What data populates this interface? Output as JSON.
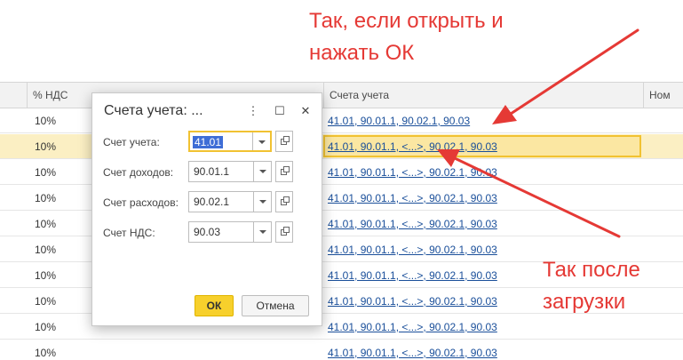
{
  "table": {
    "headers": {
      "vat": "% НДС",
      "accounts": "Счета учета",
      "next": "Ном"
    },
    "rows": [
      {
        "vat": "10%",
        "accounts": "41.01, 90.01.1, 90.02.1, 90.03",
        "selected": false
      },
      {
        "vat": "10%",
        "accounts": "41.01, 90.01.1, <...>, 90.02.1, 90.03",
        "selected": true
      },
      {
        "vat": "10%",
        "accounts": "41.01, 90.01.1, <...>, 90.02.1, 90.03",
        "selected": false
      },
      {
        "vat": "10%",
        "accounts": "41.01, 90.01.1, <...>, 90.02.1, 90.03",
        "selected": false
      },
      {
        "vat": "10%",
        "accounts": "41.01, 90.01.1, <...>, 90.02.1, 90.03",
        "selected": false
      },
      {
        "vat": "10%",
        "accounts": "41.01, 90.01.1, <...>, 90.02.1, 90.03",
        "selected": false
      },
      {
        "vat": "10%",
        "accounts": "41.01, 90.01.1, <...>, 90.02.1, 90.03",
        "selected": false
      },
      {
        "vat": "10%",
        "accounts": "41.01, 90.01.1, <...>, 90.02.1, 90.03",
        "selected": false
      },
      {
        "vat": "10%",
        "accounts": "41.01, 90.01.1, <...>, 90.02.1, 90.03",
        "selected": false
      }
    ]
  },
  "dialog": {
    "title": "Счета учета: ...",
    "more_icon": "⋮",
    "maximize_icon": "☐",
    "close_icon": "✕",
    "fields": [
      {
        "label": "Счет учета:",
        "value": "41.01"
      },
      {
        "label": "Счет доходов:",
        "value": "90.01.1"
      },
      {
        "label": "Счет расходов:",
        "value": "90.02.1"
      },
      {
        "label": "Счет НДС:",
        "value": "90.03"
      }
    ],
    "ok_label": "ОК",
    "cancel_label": "Отмена"
  },
  "annotations": {
    "top_line1": "Так, если открыть и",
    "top_line2": "нажать ОК",
    "bottom_line1": "Так после",
    "bottom_line2": "загрузки",
    "color": "#e53935"
  }
}
